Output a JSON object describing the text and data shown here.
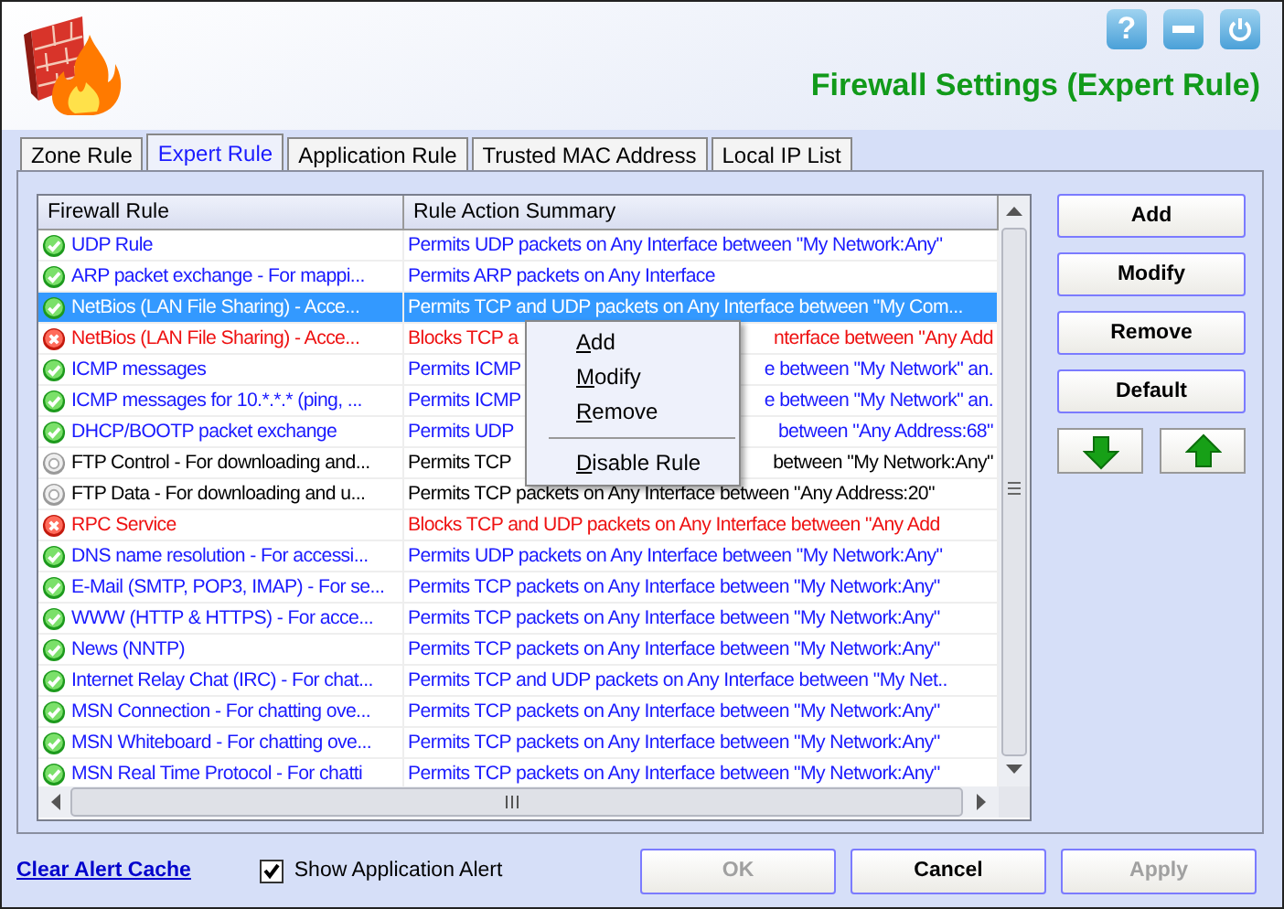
{
  "window": {
    "title": "Firewall Settings (Expert Rule)"
  },
  "header_buttons": [
    {
      "kind": "help",
      "label": "?"
    },
    {
      "kind": "minimize"
    },
    {
      "kind": "power"
    }
  ],
  "tabs": [
    {
      "label": "Zone Rule",
      "selected": false
    },
    {
      "label": "Expert Rule",
      "selected": true
    },
    {
      "label": "Application Rule",
      "selected": false
    },
    {
      "label": "Trusted MAC Address",
      "selected": false
    },
    {
      "label": "Local IP List",
      "selected": false
    }
  ],
  "table": {
    "columns": [
      "Firewall Rule",
      "Rule Action Summary"
    ],
    "rows": [
      {
        "name": "UDP Rule",
        "enabled": true,
        "blocks": false,
        "selected": false,
        "summary": [
          "Permits UDP packets on Any Interface between \"My Network:Any\""
        ]
      },
      {
        "name": "ARP packet exchange - For mappi...",
        "enabled": true,
        "blocks": false,
        "selected": false,
        "summary": [
          "Permits ARP packets on Any Interface"
        ]
      },
      {
        "name": "NetBios (LAN File Sharing) - Acce...",
        "enabled": true,
        "blocks": false,
        "selected": true,
        "summary": [
          "Permits TCP and UDP packets on Any Interface between \"My Com..."
        ]
      },
      {
        "name": "NetBios (LAN File Sharing) - Acce...",
        "enabled": true,
        "blocks": true,
        "selected": false,
        "summary": [
          "Blocks TCP a",
          "nterface between \"Any Add"
        ]
      },
      {
        "name": "ICMP messages",
        "enabled": true,
        "blocks": false,
        "selected": false,
        "summary": [
          "Permits ICMP",
          "e between \"My Network\" an."
        ]
      },
      {
        "name": "ICMP messages for  10.*.*.* (ping, ...",
        "enabled": true,
        "blocks": false,
        "selected": false,
        "summary": [
          "Permits ICMP",
          "e between \"My Network\" an."
        ]
      },
      {
        "name": "DHCP/BOOTP packet exchange",
        "enabled": true,
        "blocks": false,
        "selected": false,
        "summary": [
          "Permits UDP",
          "between \"Any Address:68\""
        ]
      },
      {
        "name": "FTP Control - For downloading and...",
        "enabled": false,
        "blocks": false,
        "selected": false,
        "summary": [
          "Permits TCP",
          "between \"My Network:Any\""
        ]
      },
      {
        "name": "FTP Data - For downloading and u...",
        "enabled": false,
        "blocks": false,
        "selected": false,
        "summary": [
          "Permits TCP packets on Any Interface between \"Any Address:20\""
        ]
      },
      {
        "name": "RPC Service",
        "enabled": true,
        "blocks": true,
        "selected": false,
        "summary": [
          "Blocks TCP and UDP packets on Any Interface between \"Any Add"
        ]
      },
      {
        "name": "DNS name resolution - For accessi...",
        "enabled": true,
        "blocks": false,
        "selected": false,
        "summary": [
          "Permits UDP packets on Any Interface between \"My Network:Any\""
        ]
      },
      {
        "name": "E-Mail (SMTP, POP3, IMAP) - For se...",
        "enabled": true,
        "blocks": false,
        "selected": false,
        "summary": [
          "Permits TCP packets on Any Interface between \"My Network:Any\""
        ]
      },
      {
        "name": "WWW (HTTP & HTTPS) - For acce...",
        "enabled": true,
        "blocks": false,
        "selected": false,
        "summary": [
          "Permits TCP packets on Any Interface between \"My Network:Any\""
        ]
      },
      {
        "name": "News (NNTP)",
        "enabled": true,
        "blocks": false,
        "selected": false,
        "summary": [
          "Permits TCP packets on Any Interface between \"My Network:Any\""
        ]
      },
      {
        "name": "Internet Relay Chat (IRC) - For chat...",
        "enabled": true,
        "blocks": false,
        "selected": false,
        "summary": [
          "Permits TCP and UDP packets on Any Interface between \"My Net.."
        ]
      },
      {
        "name": "MSN Connection - For chatting ove...",
        "enabled": true,
        "blocks": false,
        "selected": false,
        "summary": [
          "Permits TCP packets on Any Interface between \"My Network:Any\""
        ]
      },
      {
        "name": "MSN Whiteboard - For chatting ove...",
        "enabled": true,
        "blocks": false,
        "selected": false,
        "summary": [
          "Permits TCP packets on Any Interface between \"My Network:Any\""
        ]
      },
      {
        "name": "MSN Real Time Protocol - For chatti",
        "enabled": true,
        "blocks": false,
        "selected": false,
        "summary": [
          "Permits TCP packets on Any Interface between \"My Network:Any\""
        ]
      }
    ]
  },
  "context_menu": {
    "items": [
      {
        "kind": "item",
        "mnemonic": "A",
        "rest": "dd"
      },
      {
        "kind": "item",
        "mnemonic": "M",
        "rest": "odify"
      },
      {
        "kind": "item",
        "mnemonic": "R",
        "rest": "emove"
      },
      {
        "kind": "separator"
      },
      {
        "kind": "item",
        "mnemonic": "D",
        "rest": "isable Rule"
      }
    ]
  },
  "side_buttons": [
    "Add",
    "Modify",
    "Remove",
    "Default"
  ],
  "move_buttons": [
    {
      "kind": "down"
    },
    {
      "kind": "up"
    }
  ],
  "footer": {
    "link": "Clear Alert Cache",
    "checkbox": {
      "label": "Show Application Alert",
      "checked": true
    },
    "buttons": [
      {
        "label": "OK",
        "disabled": true
      },
      {
        "label": "Cancel",
        "disabled": false
      },
      {
        "label": "Apply",
        "disabled": true
      }
    ]
  }
}
